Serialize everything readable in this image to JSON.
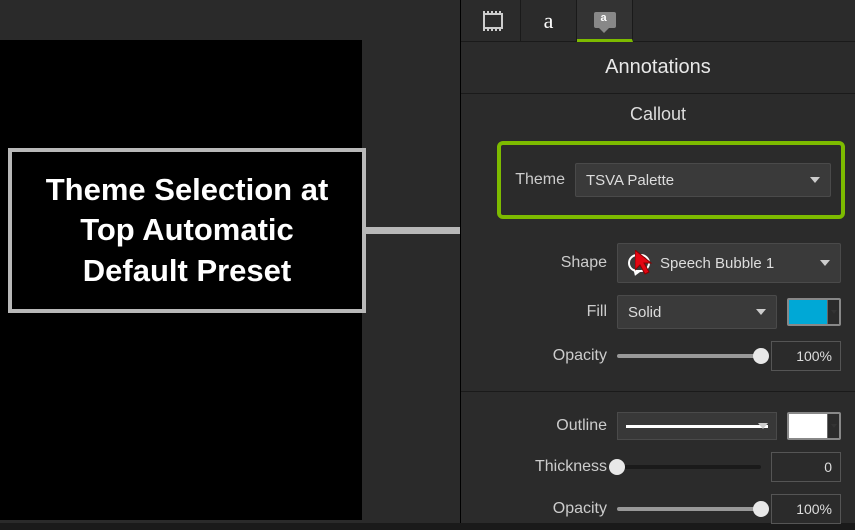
{
  "canvas": {
    "callout_text": "Theme Selection at Top Automatic Default Preset"
  },
  "panel": {
    "title": "Annotations",
    "section": "Callout",
    "theme": {
      "label": "Theme",
      "value": "TSVA Palette"
    },
    "shape": {
      "label": "Shape",
      "value": "Speech Bubble 1"
    },
    "fill": {
      "label": "Fill",
      "value": "Solid",
      "color": "#00A8D6"
    },
    "fill_opacity": {
      "label": "Opacity",
      "value": "100%",
      "pct": 100
    },
    "outline": {
      "label": "Outline",
      "color": "#FFFFFF"
    },
    "thickness": {
      "label": "Thickness",
      "value": "0",
      "pct": 0
    },
    "outline_opacity": {
      "label": "Opacity",
      "value": "100%",
      "pct": 100
    }
  },
  "tabs": {
    "text_glyph": "a"
  }
}
